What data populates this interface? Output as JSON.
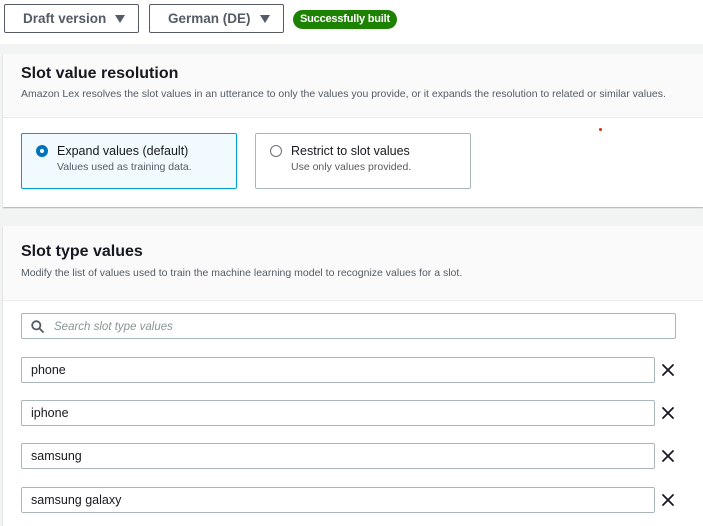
{
  "toolbar": {
    "version_dropdown": "Draft version",
    "language_dropdown": "German (DE)",
    "build_status": "Successfully built"
  },
  "resolution": {
    "title": "Slot value resolution",
    "description": "Amazon Lex resolves the slot values in an utterance to only the values you provide, or it expands the resolution to related or similar values.",
    "options": [
      {
        "label": "Expand values (default)",
        "description": "Values used as training data.",
        "selected": true
      },
      {
        "label": "Restrict to slot values",
        "description": "Use only values provided.",
        "selected": false
      }
    ]
  },
  "slot_values": {
    "title": "Slot type values",
    "description": "Modify the list of values used to train the machine learning model to recognize values for a slot.",
    "search_placeholder": "Search slot type values",
    "values": [
      "phone",
      "iphone",
      "samsung",
      "samsung galaxy"
    ]
  },
  "colors": {
    "success": "#1d8102",
    "selected_border": "#00a1c9",
    "radio_selected": "#0073bb"
  },
  "icons": [
    "caret-down-icon",
    "search-icon",
    "close-icon",
    "radio-icon"
  ]
}
